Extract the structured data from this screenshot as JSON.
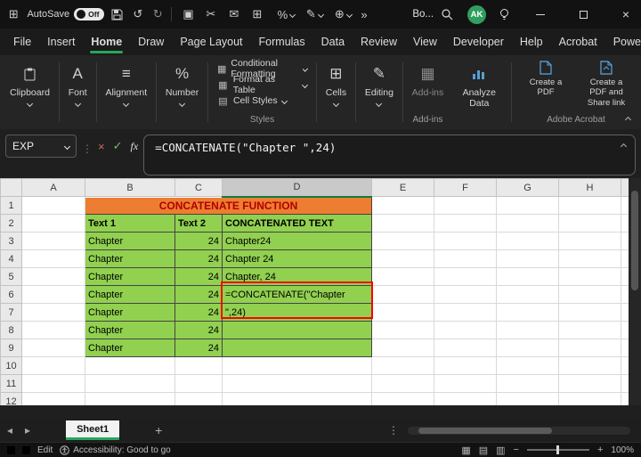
{
  "titlebar": {
    "autosave_label": "AutoSave",
    "autosave_state": "Off",
    "doc_title": "Bo...",
    "avatar_initials": "AK"
  },
  "menubar": {
    "items": [
      "File",
      "Insert",
      "Home",
      "Draw",
      "Page Layout",
      "Formulas",
      "Data",
      "Review",
      "View",
      "Developer",
      "Help",
      "Acrobat",
      "Power Pivot"
    ],
    "active": "Home"
  },
  "ribbon": {
    "clipboard_label": "Clipboard",
    "font_label": "Font",
    "alignment_label": "Alignment",
    "number_label": "Number",
    "styles": {
      "items": [
        "Conditional Formatting",
        "Format as Table",
        "Cell Styles"
      ],
      "label": "Styles"
    },
    "cells_label": "Cells",
    "editing_label": "Editing",
    "addins_button": "Add-ins",
    "addins_label": "Add-ins",
    "analyze_label": "Analyze Data",
    "pdf_label": "Create a PDF",
    "pdf_share_label": "Create a PDF and Share link",
    "acrobat_label": "Adobe Acrobat"
  },
  "formula_bar": {
    "name_box": "EXP",
    "fx": "fx",
    "formula": "=CONCATENATE(\"Chapter \",24)"
  },
  "grid": {
    "column_headers": [
      "A",
      "B",
      "C",
      "D",
      "E",
      "F",
      "G",
      "H"
    ],
    "selected_column": "D",
    "row_labels": [
      "1",
      "2",
      "3",
      "4",
      "5",
      "6",
      "7",
      "8",
      "9",
      "10",
      "11",
      "12"
    ],
    "cells": {
      "title": "CONCATENATE FUNCTION",
      "h_text1": "Text 1",
      "h_text2": "Text 2",
      "h_concat": "CONCATENATED TEXT",
      "chapter": "Chapter",
      "num": "24",
      "d3": "Chapter24",
      "d4": "Chapter 24",
      "d5": "Chapter, 24",
      "d6": "=CONCATENATE(\"Chapter",
      "d7": "\",24)"
    }
  },
  "sheet_bar": {
    "tab": "Sheet1",
    "add": "+"
  },
  "status_bar": {
    "mode": "Edit",
    "accessibility": "Accessibility: Good to go",
    "zoom": "100%"
  },
  "colors": {
    "accent_green": "#26a65b",
    "fill_green": "#92D050",
    "fill_orange": "#ED7D31",
    "title_text_red": "#B00000",
    "edit_outline_red": "#FF0000"
  },
  "icons": {
    "app_launcher": "⊞",
    "undo": "↺",
    "redo": "↻",
    "copy": "▣",
    "cut": "✂",
    "mail": "✉",
    "grid": "⊞",
    "percent": "%",
    "brush": "✎",
    "plus_circle": "⊕",
    "more": "»",
    "dots": "⋮",
    "close": "×",
    "cancel": "×",
    "check": "✓",
    "alignment": "≡",
    "font_a": "A",
    "number_pct": "%",
    "cond_format": "▦",
    "format_table": "▦",
    "cell_styles": "▤",
    "cells": "⊞",
    "editing": "✎",
    "addins": "▦",
    "sheet_prev": "◂",
    "sheet_next": "▸",
    "view_normal": "▦",
    "view_layout": "▤",
    "view_break": "▥",
    "zoom_minus": "−",
    "zoom_plus": "+"
  }
}
